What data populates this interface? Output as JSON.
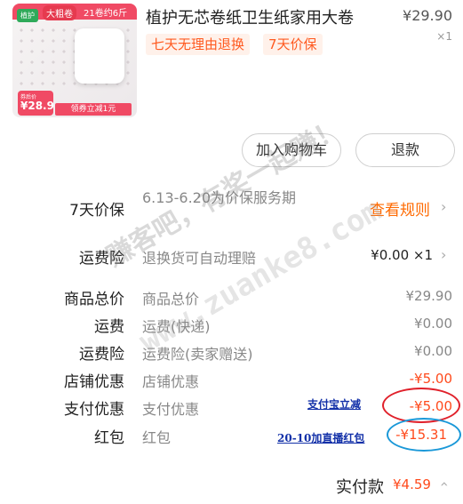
{
  "product": {
    "image": {
      "brand": "植护",
      "banner_big": "大粗卷",
      "banner_rolls": "21卷约6斤",
      "price_label": "券后价",
      "price": "¥28.9",
      "coupon": "领券立减1元"
    },
    "title": "植护无芯卷纸卫生纸家用大卷",
    "unit_price": "¥29.90",
    "quantity": "×1",
    "tags": [
      "七天无理由退换",
      "7天价保"
    ]
  },
  "actions": {
    "add_to_cart": "加入购物车",
    "refund": "退款"
  },
  "guarantee": {
    "label": "7天价保",
    "desc": "6.13-6.20为价保服务期",
    "link": "查看规则"
  },
  "shipping_insurance": {
    "label": "运费险",
    "desc": "退换货可自动理赔",
    "value": "¥0.00 ×1"
  },
  "breakdown": [
    {
      "label": "商品总价",
      "desc": "商品总价",
      "value": "¥29.90",
      "red": false
    },
    {
      "label": "运费",
      "desc": "运费(快递)",
      "value": "¥0.00",
      "red": false
    },
    {
      "label": "运费险",
      "desc": "运费险(卖家赠送)",
      "value": "¥0.00",
      "red": false
    },
    {
      "label": "店铺优惠",
      "desc": "店铺优惠",
      "value": "-¥5.00",
      "red": true
    },
    {
      "label": "支付优惠",
      "desc": "支付优惠",
      "value": "-¥5.00",
      "red": true
    },
    {
      "label": "红包",
      "desc": "红包",
      "value": "-¥15.31",
      "red": true
    }
  ],
  "annotations": {
    "alipay": "支付宝立减",
    "redpacket": "20-10加直播红包"
  },
  "total": {
    "label": "实付款",
    "value": "¥4.59"
  },
  "watermark": {
    "line1": "赚客吧，有奖一起赚！",
    "line2": "www.zuanke8.com"
  },
  "colors": {
    "accent": "#ff4a1c",
    "link": "#ff6a00",
    "annotation": "#1230a8",
    "circle_red": "#e0202a",
    "circle_blue": "#1a98d8"
  }
}
